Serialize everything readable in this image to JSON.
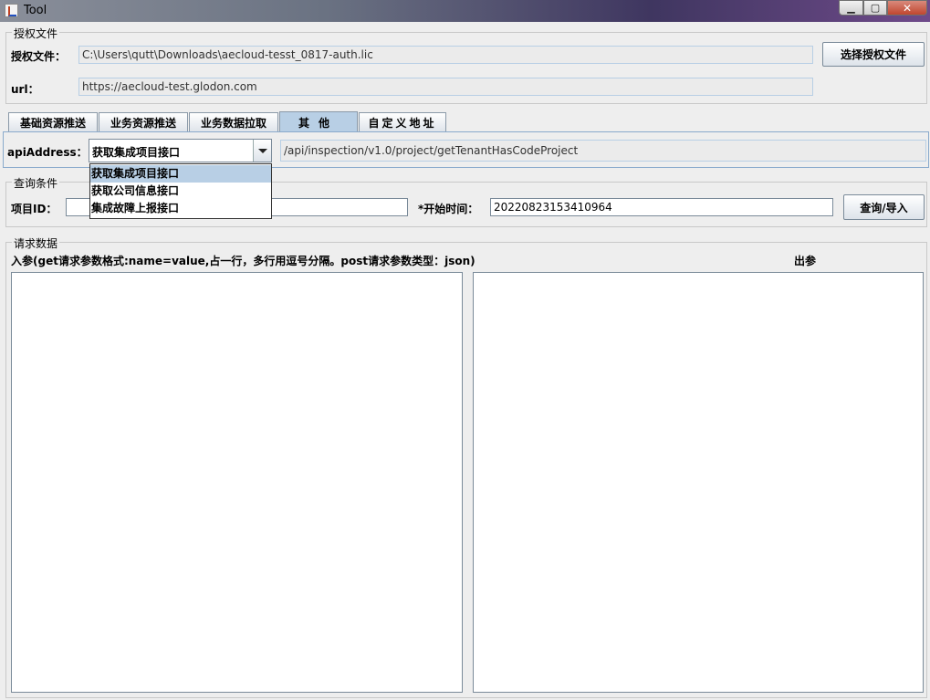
{
  "window": {
    "title": "Tool"
  },
  "auth": {
    "group_title": "授权文件",
    "file_label": "授权文件：",
    "file_value": "C:\\Users\\qutt\\Downloads\\aecloud-tesst_0817-auth.lic",
    "select_button": "选择授权文件",
    "url_label": "url：",
    "url_value": "https://aecloud-test.glodon.com"
  },
  "tabs": [
    {
      "label": "基础资源推送"
    },
    {
      "label": "业务资源推送"
    },
    {
      "label": "业务数据拉取"
    },
    {
      "label": "其他"
    },
    {
      "label": "自定义地址"
    }
  ],
  "api": {
    "label": "apiAddress：",
    "selected": "获取集成项目接口",
    "address": "/api/inspection/v1.0/project/getTenantHasCodeProject",
    "options": [
      "获取集成项目接口",
      "获取公司信息接口",
      "集成故障上报接口"
    ]
  },
  "query": {
    "group_title": "查询条件",
    "project_label": "项目ID：",
    "project_value": "",
    "start_label": "*开始时间：",
    "start_value": "20220823153410964",
    "button": "查询/导入"
  },
  "request": {
    "group_title": "请求数据",
    "input_label": "入参(get请求参数格式:name=value,占一行，多行用逗号分隔。post请求参数类型：json)",
    "output_label": "出参"
  }
}
